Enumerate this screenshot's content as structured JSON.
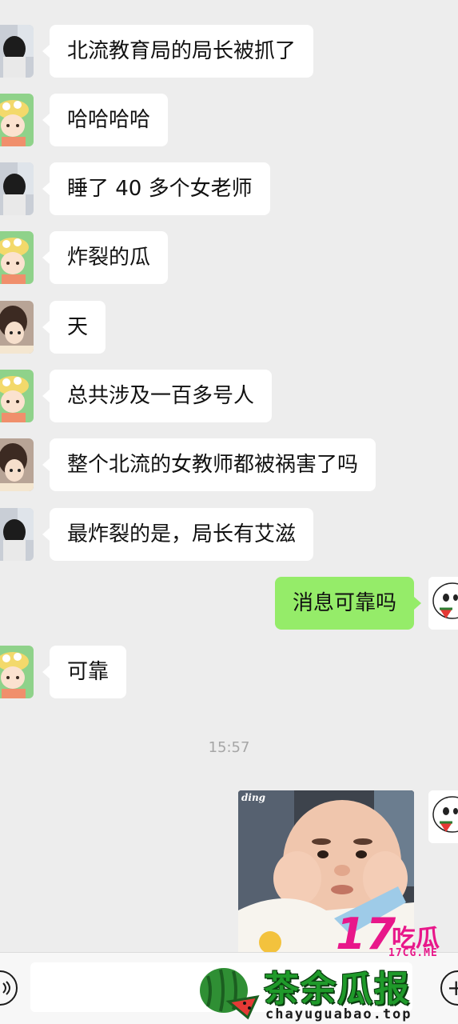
{
  "messages": [
    {
      "sender": "other",
      "avatar": "dark-hair-avatar",
      "text": "北流教育局的局长被抓了"
    },
    {
      "sender": "other",
      "avatar": "yellow-cap-avatar",
      "text": "哈哈哈哈"
    },
    {
      "sender": "other",
      "avatar": "dark-hair-avatar",
      "text": "睡了 40 多个女老师"
    },
    {
      "sender": "other",
      "avatar": "yellow-cap-avatar",
      "text": "炸裂的瓜"
    },
    {
      "sender": "other",
      "avatar": "brown-hair-avatar",
      "text": "天"
    },
    {
      "sender": "other",
      "avatar": "yellow-cap-avatar",
      "text": "总共涉及一百多号人"
    },
    {
      "sender": "other",
      "avatar": "brown-hair-avatar",
      "text": "整个北流的女教师都被祸害了吗"
    },
    {
      "sender": "other",
      "avatar": "dark-hair-avatar",
      "text": "最炸裂的是，局长有艾滋"
    },
    {
      "sender": "self",
      "avatar": "melon-face-avatar",
      "text": "消息可靠吗"
    },
    {
      "sender": "other",
      "avatar": "yellow-cap-avatar",
      "text": "可靠"
    }
  ],
  "timestamp": "15:57",
  "sticker": {
    "tag": "ding",
    "description_icon": "baby-face-sticker"
  },
  "watermarks": {
    "badge_number": "17",
    "badge_text": "吃瓜",
    "badge_domain": "17CG.ME",
    "brand_title": "茶余瓜报",
    "brand_domain": "chayuguabao.top"
  },
  "input_bar": {
    "voice_icon": "voice-icon",
    "plus_icon": "plus-icon"
  },
  "colors": {
    "background": "#ededed",
    "incoming_bubble": "#ffffff",
    "outgoing_bubble": "#95ec69",
    "watermark_pink": "#e8178a",
    "watermark_green": "#1f9a2a"
  }
}
